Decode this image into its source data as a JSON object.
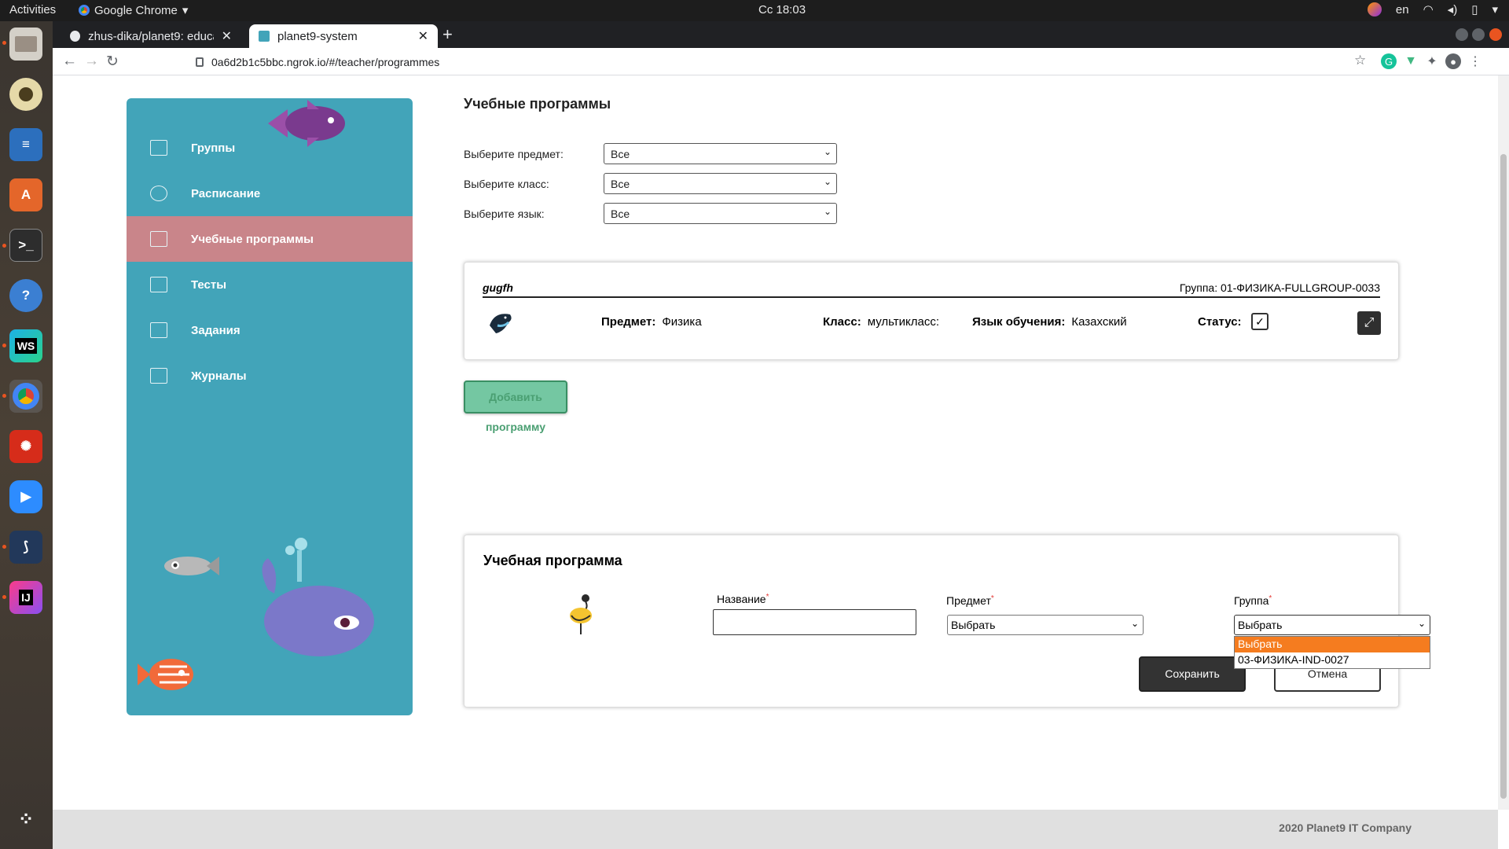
{
  "system_bar": {
    "activities": "Activities",
    "app_name": "Google Chrome",
    "clock": "Сс 18:03",
    "keyboard_layout": "en"
  },
  "browser": {
    "tabs": [
      {
        "title": "zhus-dika/planet9: educat",
        "active": false
      },
      {
        "title": "planet9-system",
        "active": true
      }
    ],
    "url": "0a6d2b1c5bbc.ngrok.io/#/teacher/programmes"
  },
  "sidebar": {
    "items": [
      {
        "label": "Группы",
        "icon": "groups-icon",
        "active": false
      },
      {
        "label": "Расписание",
        "icon": "schedule-icon",
        "active": false
      },
      {
        "label": "Учебные программы",
        "icon": "programmes-icon",
        "active": true
      },
      {
        "label": "Тесты",
        "icon": "tests-icon",
        "active": false
      },
      {
        "label": "Задания",
        "icon": "tasks-icon",
        "active": false
      },
      {
        "label": "Журналы",
        "icon": "journals-icon",
        "active": false
      }
    ]
  },
  "main": {
    "title": "Учебные программы",
    "filters": [
      {
        "label": "Выберите предмет:",
        "value": "Все"
      },
      {
        "label": "Выберите класс:",
        "value": "Все"
      },
      {
        "label": "Выберите язык:",
        "value": "Все"
      }
    ],
    "card": {
      "name": "gugfh",
      "group": "Группа: 01-ФИЗИКА-FULLGROUP-0033",
      "subject_label": "Предмет:",
      "subject": "Физика",
      "class_label": "Класс:",
      "class": "мультикласс:",
      "language_label": "Язык обучения:",
      "language": "Казахский",
      "status_label": "Статус:",
      "status_checked": true
    },
    "add_button": "Добавить программу"
  },
  "form": {
    "title": "Учебная программа",
    "name_label": "Название",
    "name_value": "",
    "subject_label": "Предмет",
    "subject_value": "Выбрать",
    "group_label": "Группа",
    "group_value": "Выбрать",
    "group_options": [
      "Выбрать",
      "03-ФИЗИКА-IND-0027"
    ],
    "required_mark": "*",
    "save": "Сохранить",
    "cancel": "Отмена"
  },
  "footer": {
    "text": "2020 Planet9 IT Company"
  },
  "colors": {
    "sidebar_bg": "#42a4b9",
    "sidebar_active": "#c9858a",
    "add_button": "#74c7a2",
    "dropdown_selected": "#f57c1f"
  }
}
